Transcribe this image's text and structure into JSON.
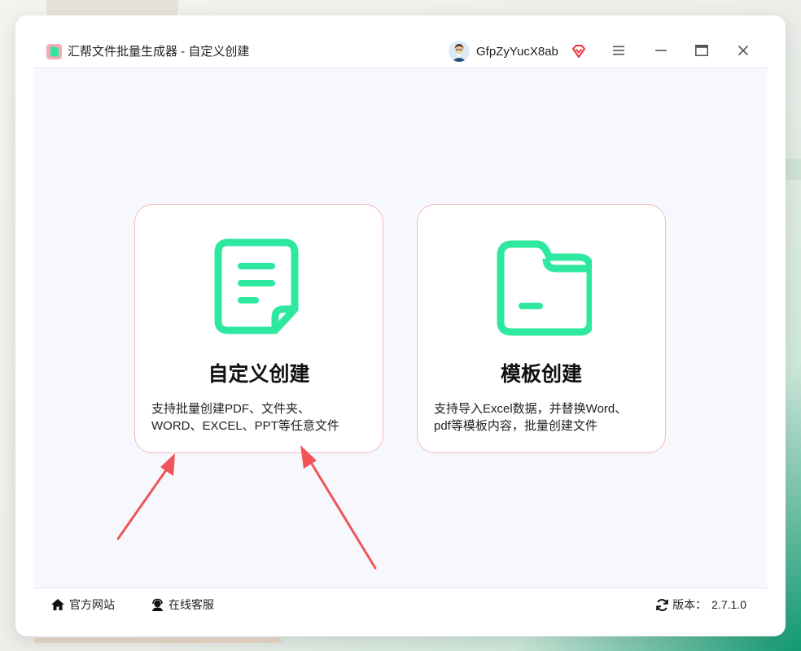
{
  "window": {
    "title": "汇帮文件批量生成器 - 自定义创建",
    "user_name": "GfpZyYucX8ab"
  },
  "icons": {
    "app": "app-logo-icon",
    "avatar": "user-avatar",
    "vip": "vip-diamond-icon",
    "menu": "hamburger-menu-icon",
    "minimize": "minimize-icon",
    "maximize": "maximize-icon",
    "close": "close-icon",
    "document": "document-icon",
    "folder": "folder-icon",
    "home": "home-icon",
    "service": "customer-service-icon",
    "refresh": "refresh-icon"
  },
  "cards": {
    "custom": {
      "title": "自定义创建",
      "desc_line1": "支持批量创建PDF、文件夹、",
      "desc_line2": "WORD、EXCEL、PPT等任意文件"
    },
    "template": {
      "title": "模板创建",
      "desc_line1": "支持导入Excel数据，并替换Word、",
      "desc_line2": "pdf等模板内容，批量创建文件"
    }
  },
  "footer": {
    "official_site": "官方网站",
    "online_service": "在线客服",
    "version_label": "版本：",
    "version_value": "2.7.1.0"
  },
  "colors": {
    "accent_green": "#2ee8a0",
    "card_border": "#f4b9c2",
    "arrow_red": "#f0545a",
    "content_bg": "#f7f8fd"
  }
}
